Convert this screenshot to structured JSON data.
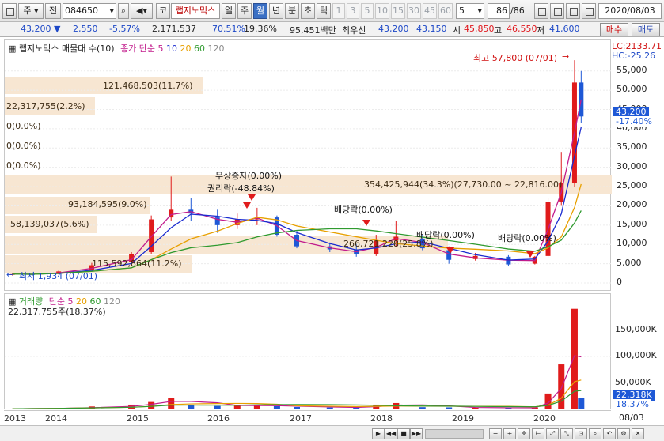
{
  "toolbar": {
    "code_type": "주",
    "previous_label": "전",
    "stock_code": "084650",
    "stock_name": "랩지노믹스",
    "kor_btn": "코",
    "periods": [
      "일",
      "주",
      "월",
      "년",
      "분",
      "초",
      "틱"
    ],
    "active_period": "월",
    "number_buttons": [
      "1",
      "3",
      "5",
      "10",
      "15",
      "30",
      "45",
      "60"
    ],
    "period_value": "5",
    "count": "86",
    "count_total": "/86",
    "date": "2020/08/03"
  },
  "quote": {
    "price": "43,200",
    "change": "2,550",
    "change_rate": "-5.57%",
    "volume": "2,171,537",
    "volume_rate": "70.51%",
    "turnover": "19.36%",
    "amount": "95,451백만",
    "best_ask_label": "최우선",
    "best_ask": "43,200",
    "best_bid": "43,150",
    "open_label": "시",
    "open": "45,850",
    "high_label": "고",
    "high": "46,550",
    "low_label": "저",
    "low": "41,600",
    "buy_button": "매수",
    "sell_button": "매도"
  },
  "price_pane": {
    "legend_title": "랩지노믹스 매물대 수(10)",
    "legend_ma_label": "종가 단순",
    "legend_ma": [
      "5",
      "10",
      "20",
      "60",
      "120"
    ],
    "lc_label": "LC:2133.71",
    "hc_label": "HC:-25.26",
    "current_price_tag": "43,200",
    "current_rate_tag": "-17.40%",
    "high_marker": "최고 57,800 (07/01)",
    "low_marker": "최저 1,934 (07/01)",
    "volume_profile": [
      {
        "label": "121,468,503(11.7%)"
      },
      {
        "label": "22,317,755(2.2%)"
      },
      {
        "label": "0(0.0%)"
      },
      {
        "label": "0(0.0%)"
      },
      {
        "label": "0(0.0%)"
      },
      {
        "label": "354,425,944(34.3%)(27,730.00 ~ 22,816.00)"
      },
      {
        "label": "93,184,595(9.0%)"
      },
      {
        "label": "58,139,037(5.6%)"
      },
      {
        "label": "266,721,228(25.8%)"
      },
      {
        "label": "115,592,864(11.2%)"
      }
    ],
    "events": [
      {
        "label": "무상증자(0.00%)"
      },
      {
        "label": "권리락(-48.84%)"
      },
      {
        "label": "배당락(0.00%)"
      },
      {
        "label": "배당락(0.00%)"
      },
      {
        "label": "배당락(0.00%)"
      }
    ],
    "y_ticks": [
      "55,000",
      "50,000",
      "45,000",
      "40,000",
      "35,000",
      "30,000",
      "25,000",
      "20,000",
      "15,000",
      "10,000",
      "5,000",
      "0"
    ]
  },
  "volume_pane": {
    "legend_title": "거래량",
    "legend_ma_label": "단순",
    "legend_ma": [
      "5",
      "20",
      "60",
      "120"
    ],
    "last_volume": "22,317,755주(18.37%)",
    "y_ticks": [
      "150,000K",
      "100,000K",
      "50,000K"
    ],
    "current_tag": "22,318K",
    "current_rate_tag": "18.37%"
  },
  "x_axis": {
    "labels": [
      "2013",
      "2014",
      "2015",
      "2016",
      "2017",
      "2018",
      "2019",
      "2020"
    ],
    "cursor_date": "08/03"
  },
  "colors": {
    "up": "#e01b1b",
    "down": "#1e58d6",
    "ma5": "#c21c8c",
    "ma10": "#1a2bd0",
    "ma20": "#e8a000",
    "ma60": "#2f9a2f",
    "ma120": "#9a9a9a"
  },
  "chart_data": {
    "type": "candlestick",
    "interval": "monthly",
    "title": "랩지노믹스",
    "y_range": [
      0,
      57800
    ],
    "series": [
      {
        "name": "종가 단순 5"
      },
      {
        "name": "종가 단순 10"
      },
      {
        "name": "종가 단순 20"
      },
      {
        "name": "종가 단순 60"
      },
      {
        "name": "종가 단순 120"
      }
    ],
    "candles": [
      {
        "date": "2013-06",
        "open": 2100,
        "high": 2500,
        "low": 1934,
        "close": 2300
      },
      {
        "date": "2013-09",
        "open": 2300,
        "high": 2800,
        "low": 2100,
        "close": 2200
      },
      {
        "date": "2014-01",
        "open": 2300,
        "high": 3200,
        "low": 2200,
        "close": 3000
      },
      {
        "date": "2014-06",
        "open": 3400,
        "high": 5200,
        "low": 3200,
        "close": 4600
      },
      {
        "date": "2014-12",
        "open": 5400,
        "high": 8000,
        "low": 5000,
        "close": 7500
      },
      {
        "date": "2015-03",
        "open": 8000,
        "high": 17500,
        "low": 7600,
        "close": 16500
      },
      {
        "date": "2015-06",
        "open": 17000,
        "high": 27600,
        "low": 16000,
        "close": 19000
      },
      {
        "date": "2015-09",
        "open": 19000,
        "high": 22000,
        "low": 16000,
        "close": 18000
      },
      {
        "date": "2016-01",
        "open": 17000,
        "high": 19000,
        "low": 13000,
        "close": 15000
      },
      {
        "date": "2016-04",
        "open": 15000,
        "high": 18000,
        "low": 14000,
        "close": 16500
      },
      {
        "date": "2016-07",
        "open": 16500,
        "high": 19500,
        "low": 15000,
        "close": 17200
      },
      {
        "date": "2016-10",
        "open": 17000,
        "high": 17500,
        "low": 12000,
        "close": 12500
      },
      {
        "date": "2017-01",
        "open": 12500,
        "high": 13500,
        "low": 9000,
        "close": 9500
      },
      {
        "date": "2017-06",
        "open": 9500,
        "high": 10500,
        "low": 8000,
        "close": 8700
      },
      {
        "date": "2017-10",
        "open": 8700,
        "high": 10000,
        "low": 6800,
        "close": 7500
      },
      {
        "date": "2018-01",
        "open": 7500,
        "high": 12500,
        "low": 7000,
        "close": 11000
      },
      {
        "date": "2018-04",
        "open": 11000,
        "high": 16000,
        "low": 9500,
        "close": 12000
      },
      {
        "date": "2018-08",
        "open": 11500,
        "high": 12500,
        "low": 8500,
        "close": 9000
      },
      {
        "date": "2018-12",
        "open": 8500,
        "high": 9500,
        "low": 5000,
        "close": 6000
      },
      {
        "date": "2019-04",
        "open": 6200,
        "high": 7800,
        "low": 5800,
        "close": 7000
      },
      {
        "date": "2019-09",
        "open": 6800,
        "high": 7200,
        "low": 4300,
        "close": 4800
      },
      {
        "date": "2020-01",
        "open": 5000,
        "high": 7000,
        "low": 4800,
        "close": 6800
      },
      {
        "date": "2020-03",
        "open": 7000,
        "high": 22000,
        "low": 6500,
        "close": 21000
      },
      {
        "date": "2020-05",
        "open": 21000,
        "high": 34000,
        "low": 20000,
        "close": 26000
      },
      {
        "date": "2020-07",
        "open": 26000,
        "high": 57800,
        "low": 25000,
        "close": 52000
      },
      {
        "date": "2020-08",
        "open": 52000,
        "high": 55000,
        "low": 41600,
        "close": 43200
      }
    ],
    "volume": [
      1200,
      1800,
      2500,
      5500,
      9000,
      14000,
      22000,
      9000,
      6500,
      7000,
      8000,
      6000,
      4500,
      3500,
      3200,
      9000,
      12000,
      4200,
      3800,
      3000,
      2500,
      3500,
      30000,
      85000,
      190000,
      22318
    ]
  }
}
